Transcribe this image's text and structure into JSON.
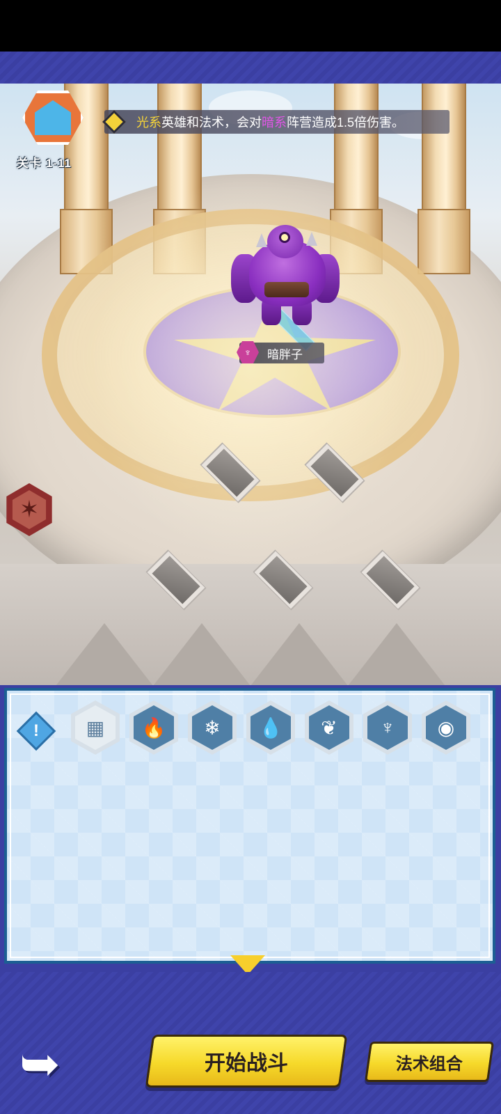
{
  "level": {
    "label": "关卡 1-11"
  },
  "tip": {
    "element_a": "光系",
    "text_a": "英雄和法术，会对",
    "element_b": "暗系",
    "text_b": "阵营造成1.5倍伤害。"
  },
  "enemy": {
    "name": "暗胖子",
    "element_icon": "dark-element-icon"
  },
  "filters": [
    {
      "name": "all",
      "glyph": "▦"
    },
    {
      "name": "fire",
      "glyph": "🔥"
    },
    {
      "name": "ice",
      "glyph": "❄"
    },
    {
      "name": "water",
      "glyph": "💧"
    },
    {
      "name": "nature",
      "glyph": "❦"
    },
    {
      "name": "dark",
      "glyph": "♆"
    },
    {
      "name": "light",
      "glyph": "◉"
    }
  ],
  "info_button": {
    "glyph": "!"
  },
  "buttons": {
    "start": "开始战斗",
    "spell_combo": "法术组合",
    "back_glyph": "➥"
  },
  "side_button": {
    "glyph": "✶"
  },
  "colors": {
    "highlight_light": "#f6d439",
    "highlight_dark": "#e056e6",
    "button_yellow": "#f6d92a",
    "frame_blue": "#3b3fa2"
  }
}
